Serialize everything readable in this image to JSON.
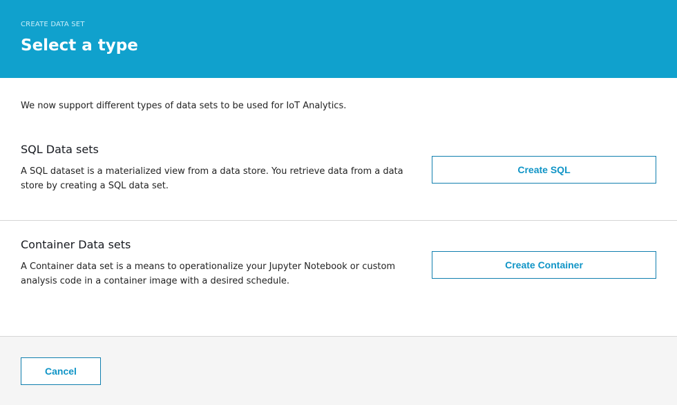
{
  "header": {
    "eyebrow": "CREATE DATA SET",
    "title": "Select a type"
  },
  "intro": "We now support different types of data sets to be used for IoT Analytics.",
  "sections": [
    {
      "title": "SQL Data sets",
      "description_line1": "A SQL dataset is a materialized view from a data store. You retrieve data from a data",
      "description_line2": "store by creating a SQL data set.",
      "button_label": "Create SQL"
    },
    {
      "title": "Container Data sets",
      "description_line1": "A Container data set is a means to operationalize your Jupyter Notebook or custom",
      "description_line2": "analysis code in a container image with a desired schedule.",
      "button_label": "Create Container"
    }
  ],
  "footer": {
    "cancel_label": "Cancel"
  },
  "colors": {
    "header_bg": "#10a1cd",
    "accent": "#0f94c6",
    "footer_bg": "#f5f5f5"
  }
}
